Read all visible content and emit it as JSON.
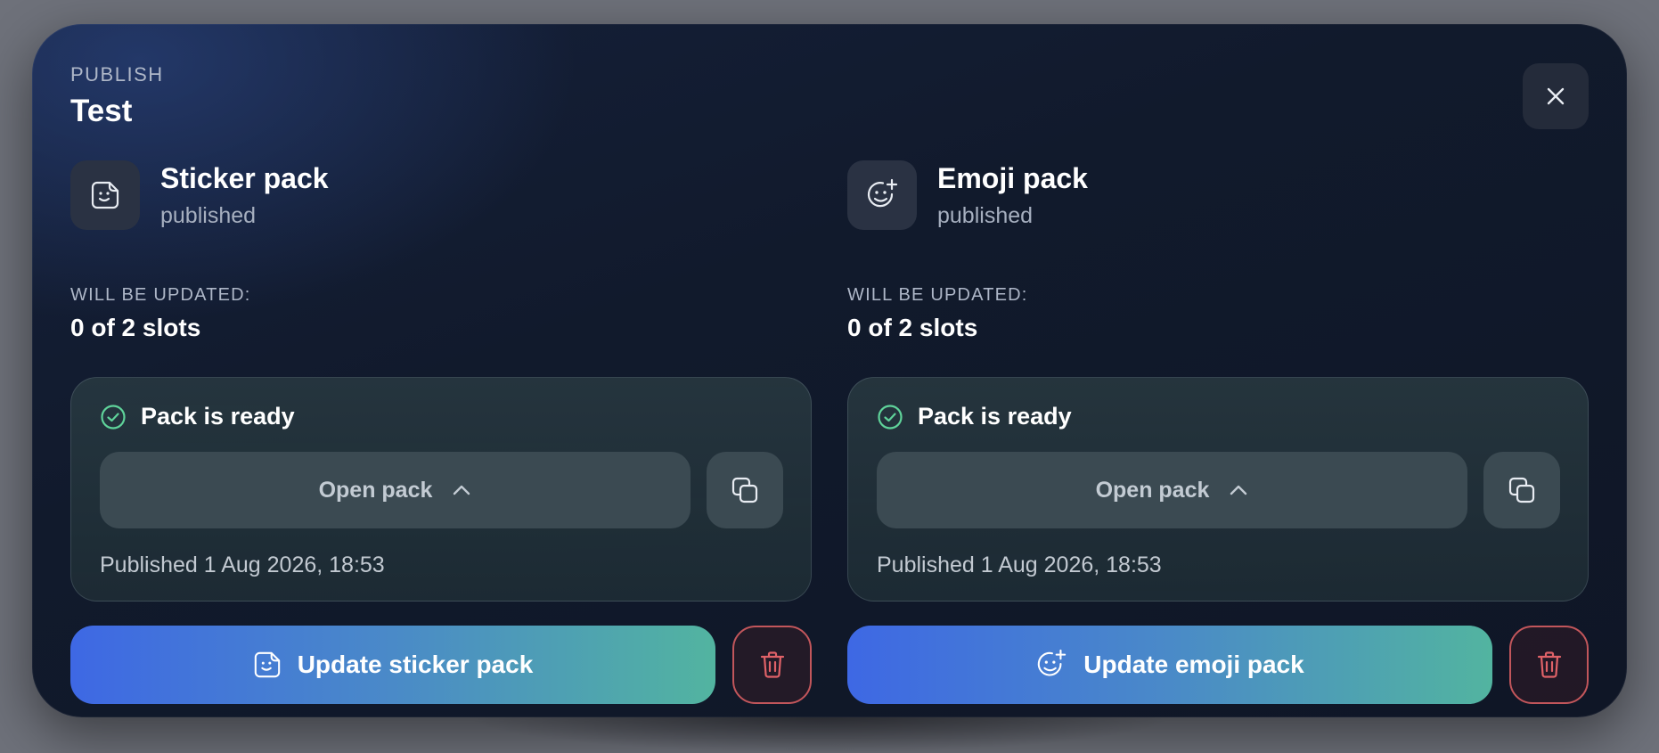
{
  "header": {
    "eyebrow": "PUBLISH",
    "title": "Test",
    "close_icon": "close-icon"
  },
  "packs": [
    {
      "icon": "sticker-icon",
      "name": "Sticker pack",
      "status": "published",
      "update_label": "WILL BE UPDATED:",
      "update_value": "0 of 2 slots",
      "ready_text": "Pack is ready",
      "open_label": "Open pack",
      "published_at": "Published 1 Aug 2026, 18:53",
      "action_label": "Update sticker pack"
    },
    {
      "icon": "emoji-add-icon",
      "name": "Emoji pack",
      "status": "published",
      "update_label": "WILL BE UPDATED:",
      "update_value": "0 of 2 slots",
      "ready_text": "Pack is ready",
      "open_label": "Open pack",
      "published_at": "Published 1 Aug 2026, 18:53",
      "action_label": "Update emoji pack"
    }
  ],
  "colors": {
    "accent_start": "#3e68e4",
    "accent_end": "#52b4a0",
    "success": "#5fd39a",
    "danger": "#e06268"
  }
}
